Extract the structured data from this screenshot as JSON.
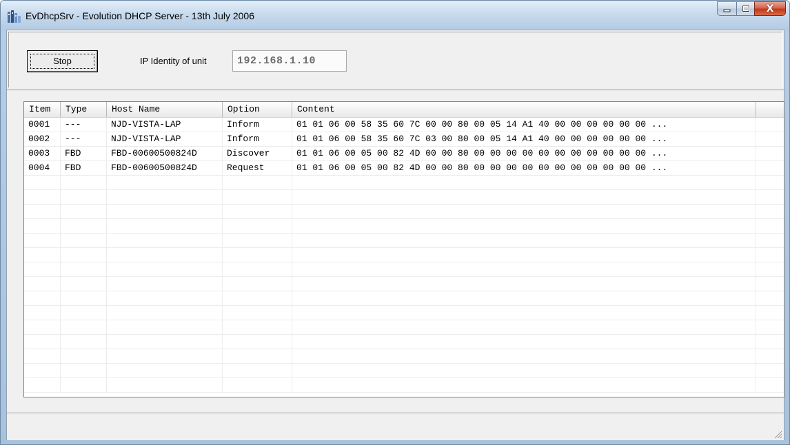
{
  "window": {
    "title": "EvDhcpSrv - Evolution DHCP Server - 13th July 2006",
    "icon": "app-building-icon"
  },
  "caption_buttons": {
    "minimize_icon": "minimize-icon",
    "maximize_icon": "maximize-icon",
    "close_icon": "close-icon",
    "close_glyph": "X"
  },
  "controls": {
    "stop_label": "Stop",
    "ip_label": "IP Identity of unit",
    "ip_value": "192.168.1.10"
  },
  "table": {
    "columns": [
      "Item",
      "Type",
      "Host Name",
      "Option",
      "Content"
    ],
    "rows": [
      {
        "item": "0001",
        "type": "---",
        "host": "NJD-VISTA-LAP",
        "option": "Inform",
        "content": "01 01 06 00 58 35 60 7C 00 00 80 00 05 14 A1 40 00 00 00 00 00 00 ..."
      },
      {
        "item": "0002",
        "type": "---",
        "host": "NJD-VISTA-LAP",
        "option": "Inform",
        "content": "01 01 06 00 58 35 60 7C 03 00 80 00 05 14 A1 40 00 00 00 00 00 00 ..."
      },
      {
        "item": "0003",
        "type": "FBD",
        "host": "FBD-00600500824D",
        "option": "Discover",
        "content": "01 01 06 00 05 00 82 4D 00 00 80 00 00 00 00 00 00 00 00 00 00 00 ..."
      },
      {
        "item": "0004",
        "type": "FBD",
        "host": "FBD-00600500824D",
        "option": "Request",
        "content": "01 01 06 00 05 00 82 4D 00 00 80 00 00 00 00 00 00 00 00 00 00 00 ..."
      }
    ]
  },
  "colors": {
    "frame": "#b7cde4",
    "close_button": "#c0391b"
  }
}
